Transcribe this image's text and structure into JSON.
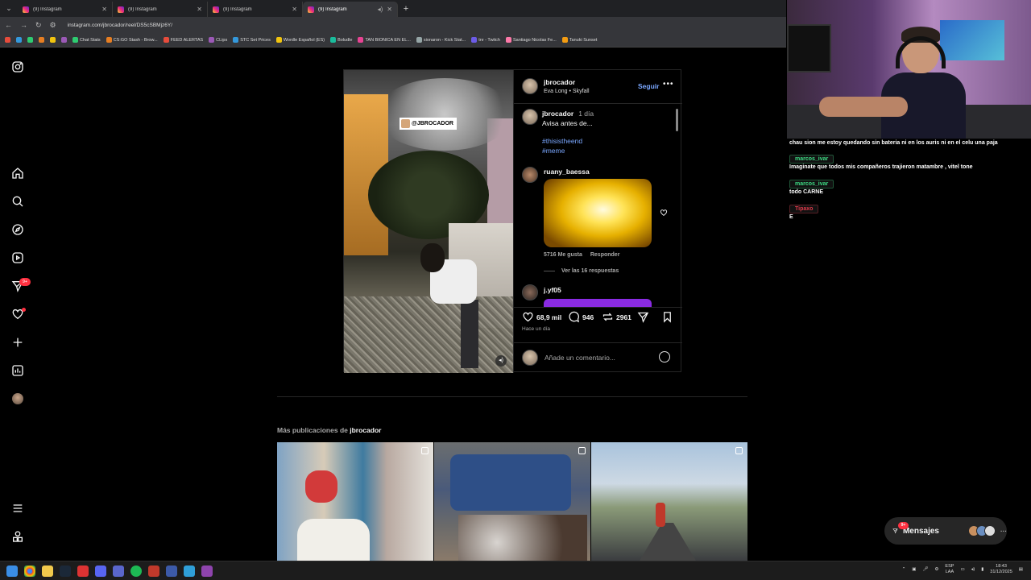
{
  "browser": {
    "tabs": [
      {
        "title": "(9) Instagram"
      },
      {
        "title": "(9) Instagram"
      },
      {
        "title": "(9) Instagram"
      },
      {
        "title": "(9) Instagram",
        "active": true
      }
    ],
    "url": "instagram.com/jbrocador/reel/DS5cSBMjz6Y/",
    "bookmarks": [
      "Chat Stats",
      "CS:GO Stash - Brow...",
      "FEED ALERTAS",
      "CLips",
      "STC Set Prices",
      "Wordle Español (ES)",
      "Boludle",
      "TAN BIONICA EN EL...",
      "sionaron - Kick Stat...",
      "tnr - Twitch",
      "Santiago Nicolas Fe...",
      "Tanuki Sunset"
    ]
  },
  "sidebar": {
    "icons": [
      "instagram-logo-icon",
      "home-icon",
      "search-icon",
      "explore-icon",
      "reels-icon",
      "messages-icon",
      "notifications-icon",
      "create-icon",
      "dashboard-icon",
      "profile-avatar",
      "menu-icon",
      "also-from-meta-icon"
    ],
    "messages_badge": "9+"
  },
  "post": {
    "author": "jbrocador",
    "audio": "Eva Long • Skyfall",
    "follow_label": "Seguir",
    "watermark": "@JBROCADOR",
    "caption": {
      "user": "jbrocador",
      "time": "1 día",
      "text": "Avisa antes de...",
      "hashtags": [
        "#thisistheend",
        "#meme"
      ]
    },
    "comments": [
      {
        "user": "ruany_baessa",
        "likes": "5716 Me gusta",
        "reply_label": "Responder",
        "view_replies": "Ver las 16 respuestas"
      },
      {
        "user": "j.yf05"
      }
    ],
    "likes": "68,9 mil",
    "comment_count": "946",
    "reposts": "2961",
    "posted_time": "Hace un día",
    "add_comment_placeholder": "Añade un comentario..."
  },
  "more_posts": {
    "prefix": "Más publicaciones de",
    "user": "jbrocador"
  },
  "dm": {
    "label": "Mensajes",
    "badge": "9+"
  },
  "stream_chat": [
    {
      "type": "msg",
      "text": "chau sion me estoy quedando sin bateria ni en los auris ni en el celu una paja"
    },
    {
      "type": "name",
      "text": "marcos_ivar",
      "color": "#3ddc84"
    },
    {
      "type": "msg",
      "text": "Imaginate que todos mis compañeros trajieron matambre , vitel tone"
    },
    {
      "type": "name",
      "text": "marcos_ivar",
      "color": "#3ddc84"
    },
    {
      "type": "msg",
      "text": "todo CARNE"
    },
    {
      "type": "name",
      "text": "Tipaxo",
      "color": "#e0394a"
    },
    {
      "type": "msg",
      "text": "E"
    }
  ],
  "taskbar": {
    "lang": "ESP",
    "lang_sub": "LAA",
    "time": "18:43",
    "date": "31/12/2025"
  },
  "colors": {
    "accent_link": "#7aa7ff",
    "badge_red": "#ff3040"
  }
}
